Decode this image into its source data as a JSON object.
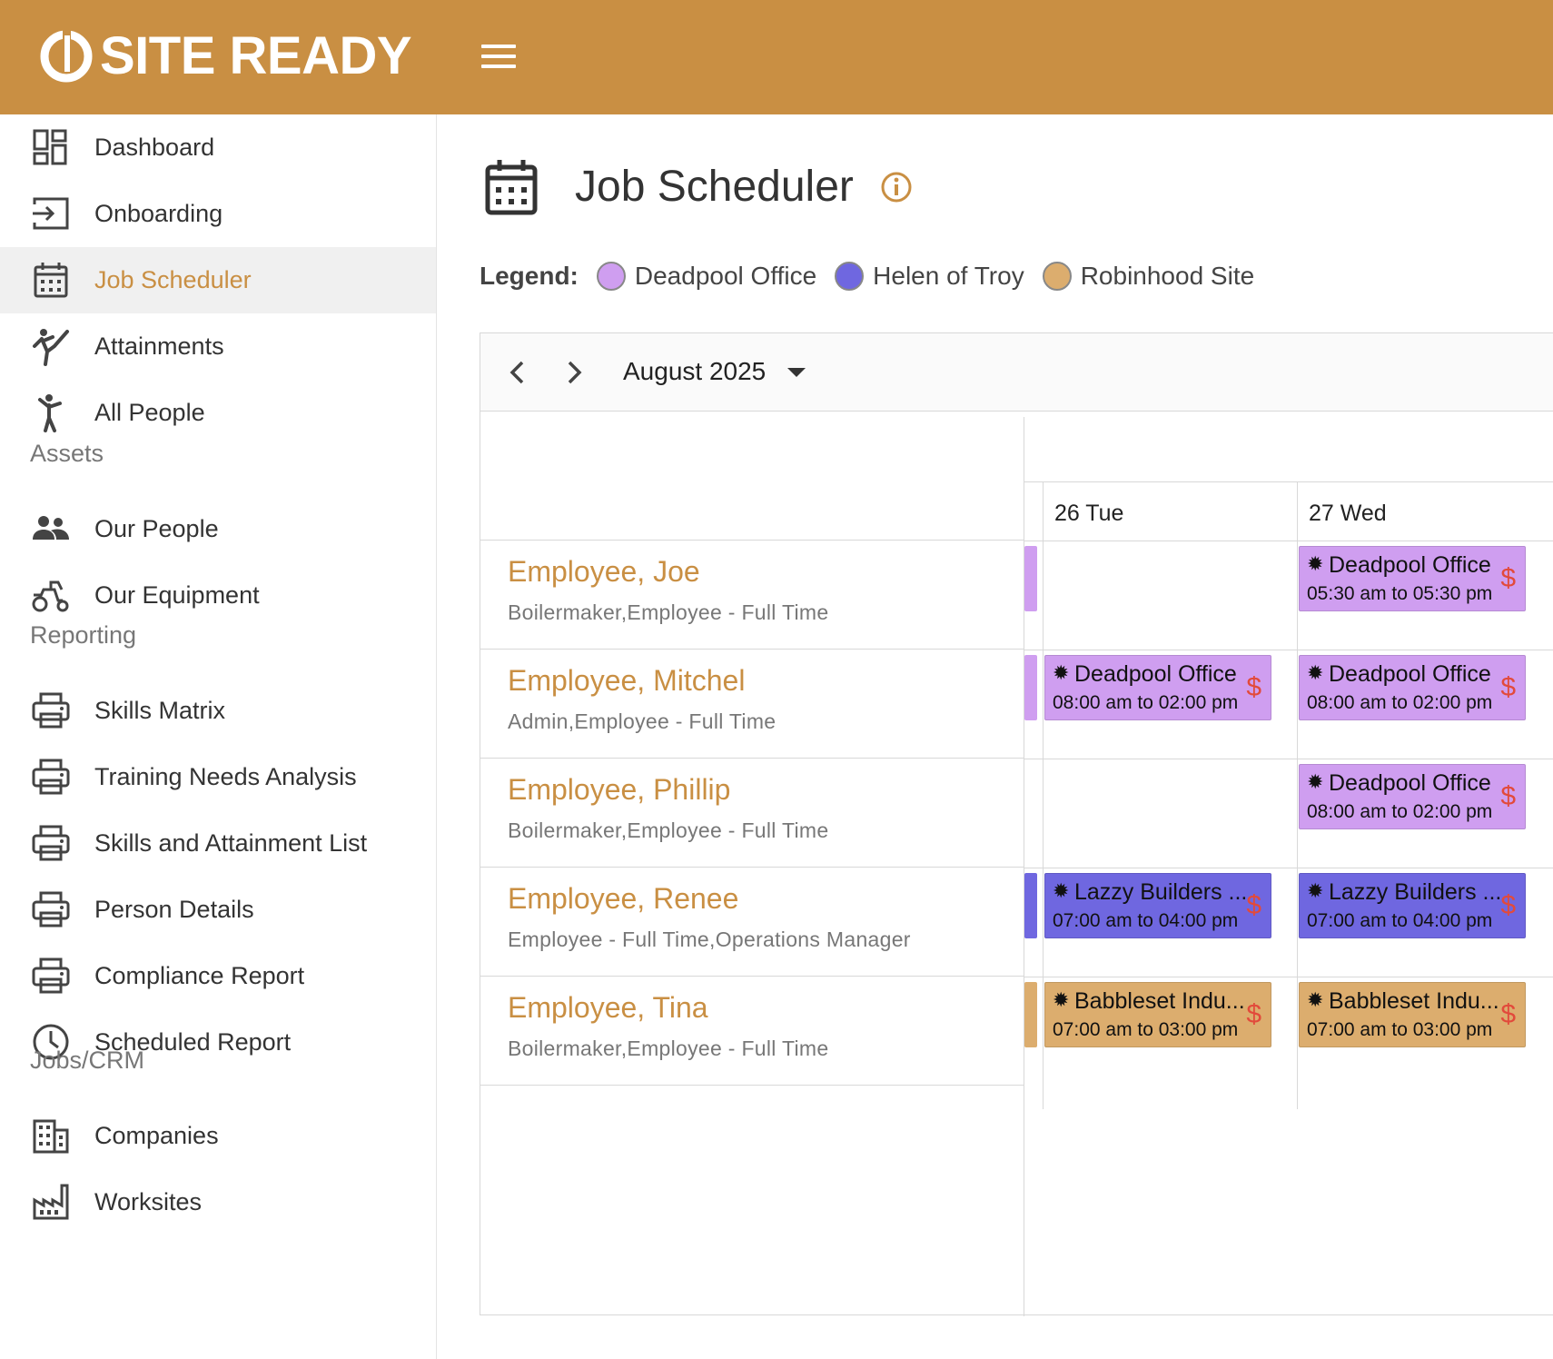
{
  "app": {
    "name": "SITE READY"
  },
  "colors": {
    "brand": "#c98f43",
    "deadpool": "#cf9ef0",
    "helen": "#6f67e0",
    "robinhood": "#dcad6e",
    "dollar": "#e24a3b"
  },
  "sidebar": {
    "main": [
      {
        "label": "Dashboard",
        "icon": "dashboard-icon"
      },
      {
        "label": "Onboarding",
        "icon": "onboarding-icon"
      },
      {
        "label": "Job Scheduler",
        "icon": "calendar-icon"
      },
      {
        "label": "Attainments",
        "icon": "attainments-icon"
      },
      {
        "label": "All People",
        "icon": "person-icon"
      }
    ],
    "assets_heading": "Assets",
    "assets": [
      {
        "label": "Our People",
        "icon": "people-icon"
      },
      {
        "label": "Our Equipment",
        "icon": "equipment-icon"
      }
    ],
    "reporting_heading": "Reporting",
    "reporting": [
      {
        "label": "Skills Matrix",
        "icon": "printer-icon"
      },
      {
        "label": "Training Needs Analysis",
        "icon": "printer-icon"
      },
      {
        "label": "Skills and Attainment List",
        "icon": "printer-icon"
      },
      {
        "label": "Person Details",
        "icon": "printer-icon"
      },
      {
        "label": "Compliance Report",
        "icon": "printer-icon"
      },
      {
        "label": "Scheduled Report",
        "icon": "clock-icon"
      }
    ],
    "jobs_heading": "Jobs/CRM",
    "jobs": [
      {
        "label": "Companies",
        "icon": "building-icon"
      },
      {
        "label": "Worksites",
        "icon": "factory-icon"
      }
    ]
  },
  "page": {
    "title": "Job Scheduler"
  },
  "legend": {
    "title": "Legend:",
    "items": [
      {
        "label": "Deadpool Office",
        "color": "#cf9ef0"
      },
      {
        "label": "Helen of Troy",
        "color": "#6f67e0"
      },
      {
        "label": "Robinhood Site",
        "color": "#dcad6e"
      }
    ]
  },
  "scheduler": {
    "month": "August 2025",
    "days": [
      "26 Tue",
      "27 Wed"
    ],
    "employees": [
      {
        "name": "Employee, Joe",
        "role": "Boilermaker,Employee - Full Time"
      },
      {
        "name": "Employee, Mitchel",
        "role": "Admin,Employee - Full Time"
      },
      {
        "name": "Employee, Phillip",
        "role": "Boilermaker,Employee - Full Time"
      },
      {
        "name": "Employee, Renee",
        "role": "Employee - Full Time,Operations Manager"
      },
      {
        "name": "Employee, Tina",
        "role": "Boilermaker,Employee - Full Time"
      }
    ],
    "events": [
      {
        "row": 0,
        "day": 1,
        "title": "Deadpool Office",
        "time": "05:30 am to 05:30 pm",
        "site": "deadpool"
      },
      {
        "row": 1,
        "day": 0,
        "title": "Deadpool Office",
        "time": "08:00 am to 02:00 pm",
        "site": "deadpool"
      },
      {
        "row": 1,
        "day": 1,
        "title": "Deadpool Office",
        "time": "08:00 am to 02:00 pm",
        "site": "deadpool"
      },
      {
        "row": 2,
        "day": 1,
        "title": "Deadpool Office",
        "time": "08:00 am to 02:00 pm",
        "site": "deadpool"
      },
      {
        "row": 3,
        "day": 0,
        "title": "Lazzy Builders ...",
        "time": "07:00 am to 04:00 pm",
        "site": "helen"
      },
      {
        "row": 3,
        "day": 1,
        "title": "Lazzy Builders ...",
        "time": "07:00 am to 04:00 pm",
        "site": "helen"
      },
      {
        "row": 4,
        "day": 0,
        "title": "Babbleset Indu...",
        "time": "07:00 am to 03:00 pm",
        "site": "robinhood"
      },
      {
        "row": 4,
        "day": 1,
        "title": "Babbleset Indu...",
        "time": "07:00 am to 03:00 pm",
        "site": "robinhood"
      }
    ],
    "slivers": [
      {
        "row": 0,
        "site": "deadpool"
      },
      {
        "row": 1,
        "site": "deadpool"
      },
      {
        "row": 3,
        "site": "helen"
      },
      {
        "row": 4,
        "site": "robinhood"
      }
    ],
    "event_marker": "$"
  }
}
